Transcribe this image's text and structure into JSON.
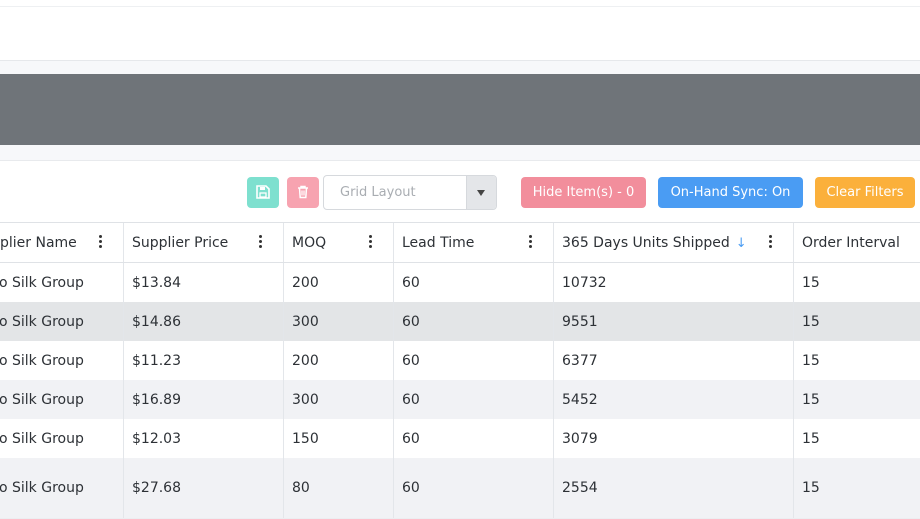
{
  "toolbar": {
    "layout_placeholder": "Grid Layout",
    "hide_items_label": "Hide Item(s) - 0",
    "on_hand_sync_label": "On-Hand Sync: On",
    "clear_filters_label": "Clear Filters"
  },
  "colors": {
    "banner": "#6f7479",
    "save": "#7ee0cf",
    "delete": "#f7a3b0",
    "hide_items": "#f28e9c",
    "on_hand_sync": "#4a9cf3",
    "clear_filters": "#fbb03b",
    "row_striped": "#f1f2f5",
    "row_hover": "#e3e5e7"
  },
  "table": {
    "columns": [
      "plier Name",
      "Supplier Price",
      "MOQ",
      "Lead Time",
      "365 Days Units Shipped",
      "Order Interval"
    ],
    "sort_indicator": "↓",
    "rows": [
      [
        "o Silk Group",
        "$13.84",
        "200",
        "60",
        "10732",
        "15"
      ],
      [
        "o Silk Group",
        "$14.86",
        "300",
        "60",
        "9551",
        "15"
      ],
      [
        "o Silk Group",
        "$11.23",
        "200",
        "60",
        "6377",
        "15"
      ],
      [
        "o Silk Group",
        "$16.89",
        "300",
        "60",
        "5452",
        "15"
      ],
      [
        "o Silk Group",
        "$12.03",
        "150",
        "60",
        "3079",
        "15"
      ],
      [
        "o Silk Group",
        "$27.68",
        "80",
        "60",
        "2554",
        "15"
      ]
    ]
  }
}
